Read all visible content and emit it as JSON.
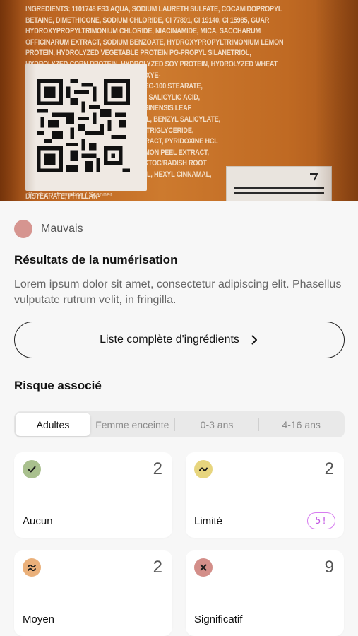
{
  "scan": {
    "ingredients_print": "INGREDIENTS: 1101748 FS3 AQUA, SODIUM LAURETH SULFATE, COCAMIDOPROPYL BETAINE, DIMETHICONE, SODIUM CHLORIDE, CI 77891, CI 19140, CI 15985, GUAR HYDROXYPROPYLTRIMONIUM CHLORIDE, NIACINAMIDE, MICA, SACCHARUM OFFICINARUM EXTRACT, SODIUM BENZOATE, HYDROXYPROPYLTRIMONIUM LEMON PROTEIN, HYDROLYZED VEGETABLE PROTEIN PG-PROPYL SILANETRIOL, HYDROLYZED CORN PROTEIN, HYDROLYZED SOY PROTEIN, HYDROLYZED WHEAT PROTEIN, SODIUM HYDROXIDE, PHENOXYE-\n                                                          THANOL, STEARETH-6, ACETIC ACID, PEG-100 STEARATE,\n                                                          PEG-45M, TRIDECETH-10, TRIDECETH-3, SALICYLIC ACID,\n                                                          LIMONENE, FUMARIC ACID, CAMELLIA SINENSIS LEAF\n                                                          EXTRACT, LINALOOL, BENZYL ALCOHOL, BENZYL SALICYLATE,\n                                                          AMODIMETHICONE, CAPRYLIC/CAPRIC TRIGLYCERIDE,\n                                                          CARBOMER, PYRUS MALUS FRUIT EXTRACT, PYRIDOXINE HCL\n                                                          CITRIC ACID, CITRONELLOL, CITRUS LIMON PEEL EXTRACT,\n                                                          POTASSIUM SORBATE, BHT, LEUCONOSTOC/RADISH ROOT\n                                                          FERMENT FILTRATE, HEXYLENE GLYCOL, HEXYL CINNAMAL,\n                                                          GLYCERIN, GLYCOL\n                                                          DISTEARATE, PHYLLAN-\n                                                          THUS EMBLICA FRUIT",
    "qr_caption": "Product information / Scanner"
  },
  "rating": {
    "label": "Mauvais",
    "color": "#d69590"
  },
  "results": {
    "title": "Résultats de la numérisation",
    "description": "Lorem ipsum dolor sit amet, consectetur adipiscing elit. Phasellus vulputate rutrum velit, in fringilla."
  },
  "ingredients_button": {
    "label": "Liste complète d'ingrédients",
    "icon": "chevron-right-icon"
  },
  "risk": {
    "title": "Risque associé",
    "tabs": [
      {
        "label": "Adultes",
        "active": true
      },
      {
        "label": "Femme enceinte",
        "active": false
      },
      {
        "label": "0-3 ans",
        "active": false
      },
      {
        "label": "4-16 ans",
        "active": false
      }
    ],
    "cards": [
      {
        "name": "Aucun",
        "count": "2",
        "icon": "check-icon",
        "color": "#a9c08e"
      },
      {
        "name": "Limité",
        "count": "2",
        "icon": "tilde-icon",
        "color": "#e7d57e",
        "warning": "5!"
      },
      {
        "name": "Moyen",
        "count": "2",
        "icon": "approx-icon",
        "color": "#eab07a"
      },
      {
        "name": "Significatif",
        "count": "9",
        "icon": "cross-icon",
        "color": "#d38e89"
      }
    ]
  }
}
